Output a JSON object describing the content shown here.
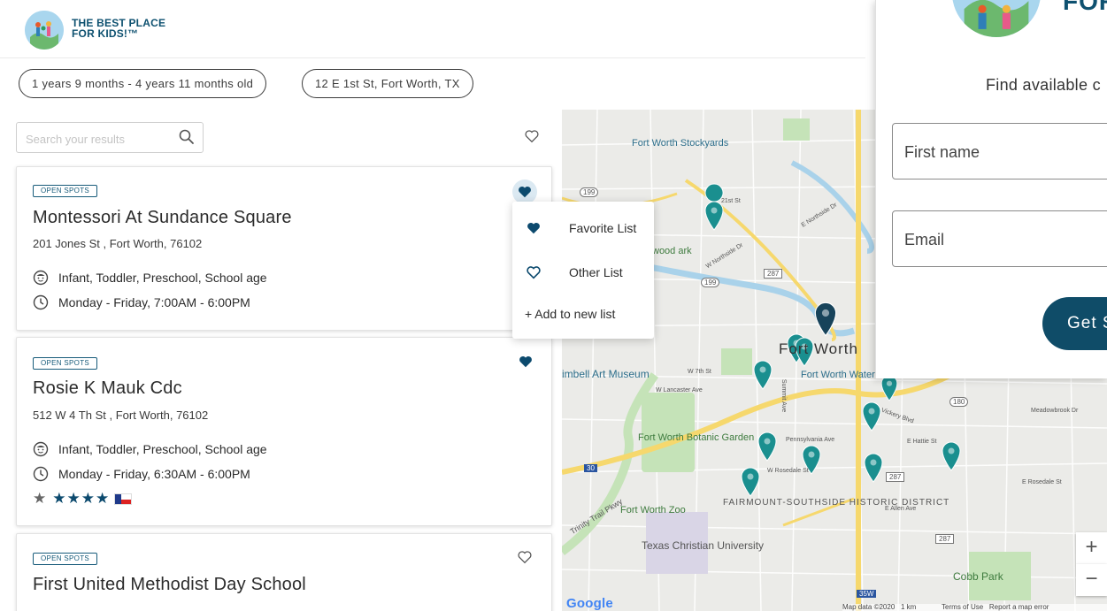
{
  "brand": {
    "line1": "THE BEST PLACE",
    "line2": "FOR KIDS!™"
  },
  "filters": {
    "age": "1 years 9 months - 4 years 11 months old",
    "location": "12 E 1st St, Fort Worth, TX"
  },
  "search": {
    "placeholder": "Search your results",
    "value": ""
  },
  "results": [
    {
      "badge": "OPEN SPOTS",
      "name": "Montessori At Sundance Square",
      "address": "201 Jones St , Fort Worth, 76102",
      "ages": "Infant, Toddler, Preschool, School age",
      "hours": "Monday - Friday, 7:00AM - 6:00PM",
      "favorited": true
    },
    {
      "badge": "OPEN SPOTS",
      "name": "Rosie K Mauk Cdc",
      "address": "512 W 4 Th St , Fort Worth, 76102",
      "ages": "Infant, Toddler, Preschool, School age",
      "hours": "Monday - Friday, 6:30AM - 6:00PM",
      "rating_stars": "★★★★",
      "favorited": true
    },
    {
      "badge": "OPEN SPOTS",
      "name": "First United Methodist Day School",
      "favorited": false
    }
  ],
  "favorites_menu": {
    "items": [
      {
        "label": "Favorite List",
        "icon": "heart-filled-icon"
      },
      {
        "label": "Other List",
        "icon": "heart-outline-icon"
      }
    ],
    "add_label": "+ Add to new list"
  },
  "map": {
    "labels": {
      "stockyards": "Fort Worth Stockyards",
      "city": "Fort Worth",
      "water_garden": "Fort Worth Water Garden",
      "kimbell": "imbell Art Museum",
      "botanic": "Fort Worth Botanic Garden",
      "zoo": "Fort Worth Zoo",
      "fairmount": "FAIRMOUNT-SOUTHSIDE HISTORIC DISTRICT",
      "tcu": "Texas Christian University",
      "cobb": "Cobb Park",
      "wood": "wood ark",
      "trinity": "Trinity Trail Pkwy",
      "lancaster": "W Lancaster Ave",
      "rosedale": "W Rosedale St",
      "pennsylvania": "Pennsylvania Ave",
      "vickery": "Vickery Blvd",
      "hattie": "E Hattie St",
      "allen": "E Allen Ave",
      "meadowbrook": "Meadowbrook Dr",
      "e_rosedale": "E Rosedale St",
      "northside": "W Northside Dr",
      "e_northside": "E Northside Dr",
      "seventh": "W 7th St",
      "twentyfirst": "21st St",
      "summit": "Summit Ave"
    },
    "shields": {
      "s199a": "199",
      "s199b": "199",
      "s287a": "287",
      "s287b": "287",
      "s287c": "287",
      "s180": "180",
      "s30": "30",
      "s35w": "35W"
    },
    "google": "Google",
    "footer": {
      "data": "Map data ©2020",
      "scale": "1 km",
      "terms": "Terms of Use",
      "report": "Report a map error"
    },
    "zoom_in": "+",
    "zoom_out": "−",
    "colors": {
      "pin": "#1a8f8f",
      "pin_selected": "#17435a",
      "water": "#a9d2ea",
      "park": "#c5e3b8",
      "highway": "#f6d86d"
    }
  },
  "signup": {
    "logo_text": "FOR",
    "subtitle": "Find available c",
    "first_name_placeholder": "First name",
    "email_placeholder": "Email",
    "button_label": "Get S"
  },
  "colors": {
    "brand": "#0e5170",
    "accent": "#0c4a6e",
    "heart": "#0c4a6e"
  }
}
